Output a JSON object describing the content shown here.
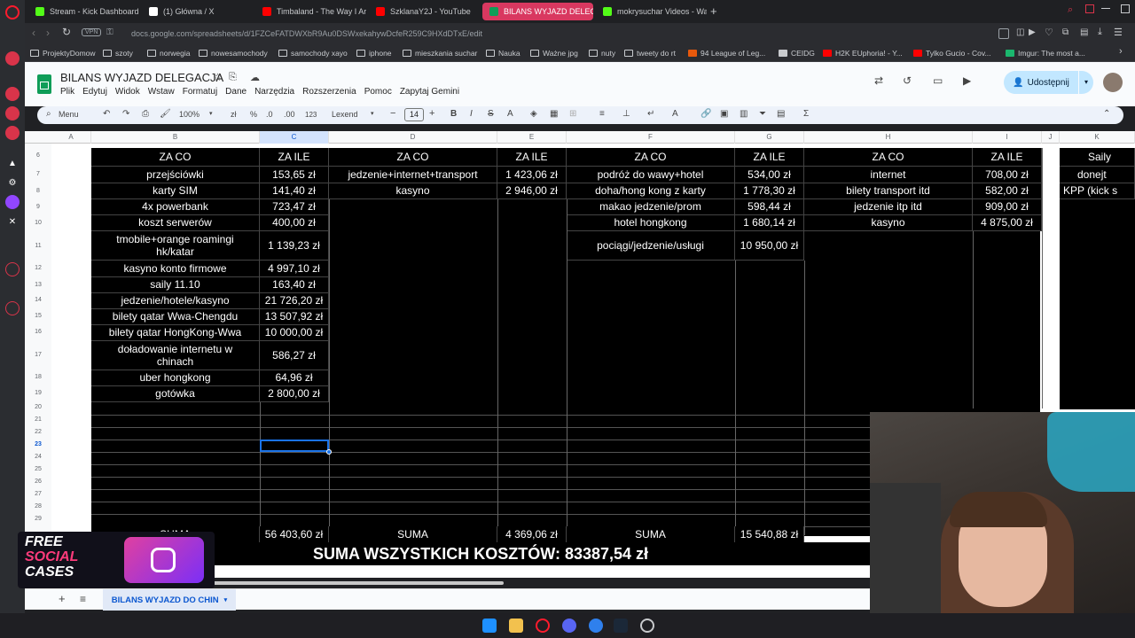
{
  "browser": {
    "tabs": [
      {
        "label": "Stream - Kick Dashboard",
        "color": "#53fc18",
        "active": false
      },
      {
        "label": "(1) Główna / X",
        "color": "#ffffff",
        "active": false
      },
      {
        "label": "Timbaland - The Way I Are",
        "color": "#ff0000",
        "active": false
      },
      {
        "label": "SzklanaY2J - YouTube",
        "color": "#ff0000",
        "active": false
      },
      {
        "label": "BILANS WYJAZD DELEGACJA",
        "color": "#0f9d58",
        "active": true
      },
      {
        "label": "mokrysuchar Videos - Wa...",
        "color": "#53fc18",
        "active": false
      }
    ],
    "vpn_label": "VPN",
    "url": "docs.google.com/spreadsheets/d/1FZCeFATDWXbR9Au0DSWxekahywDcfeR259C9HXdDTxE/edit",
    "bookmarks": [
      "ProjektyDomow",
      "szoty",
      "norwegia",
      "nowesamochody",
      "samochody xayo",
      "iphone",
      "mieszkania suchar",
      "Nauka",
      "Ważne jpg",
      "nuty",
      "tweety do rt",
      "94 League of Leg...",
      "CEIDG",
      "H2K EUphoria! - Y...",
      "Tylko Gucio - Cov...",
      "Imgur: The most a..."
    ]
  },
  "sheets": {
    "title": "BILANS WYJAZD DELEGACJA",
    "menu": [
      "Plik",
      "Edytuj",
      "Widok",
      "Wstaw",
      "Formatuj",
      "Dane",
      "Narzędzia",
      "Rozszerzenia",
      "Pomoc",
      "Zapytaj Gemini"
    ],
    "share_label": "Udostępnij",
    "toolbar": {
      "menu_label": "Menu",
      "zoom": "100%",
      "number_format": "123",
      "font": "Lexend",
      "font_size": "14"
    },
    "columns": [
      "A",
      "B",
      "C",
      "D",
      "E",
      "F",
      "G",
      "H",
      "I",
      "J",
      "K"
    ],
    "rows": [
      "6",
      "7",
      "8",
      "9",
      "10",
      "11",
      "12",
      "13",
      "14",
      "15",
      "16",
      "17",
      "18",
      "19",
      "20",
      "21",
      "22",
      "23",
      "24",
      "25",
      "26",
      "27",
      "28",
      "29"
    ],
    "headers": {
      "b": "ZA CO",
      "c": "ZA ILE",
      "d": "ZA CO",
      "e": "ZA ILE",
      "f": "ZA CO",
      "g": "ZA ILE",
      "h": "ZA CO",
      "i": "ZA ILE",
      "k": "Saily"
    },
    "col_b": [
      "przejściówki",
      "karty SIM",
      "4x powerbank",
      "koszt serwerów",
      "tmobile+orange roamingi hk/katar",
      "kasyno konto firmowe",
      "saily 11.10",
      "jedzenie/hotele/kasyno",
      "bilety qatar Wwa-Chengdu",
      "bilety qatar HongKong-Wwa",
      "doładowanie internetu w chinach",
      "uber hongkong",
      "gotówka"
    ],
    "col_c": [
      "153,65 zł",
      "141,40 zł",
      "723,47 zł",
      "400,00 zł",
      "1 139,23 zł",
      "4 997,10 zł",
      "163,40 zł",
      "21 726,20 zł",
      "13 507,92 zł",
      "10 000,00 zł",
      "586,27 zł",
      "64,96 zł",
      "2 800,00 zł"
    ],
    "col_d": [
      "jedzenie+internet+transport",
      "kasyno"
    ],
    "col_e": [
      "1 423,06 zł",
      "2 946,00 zł"
    ],
    "col_f": [
      "podróż do wawy+hotel",
      "doha/hong kong z karty",
      "makao jedzenie/prom",
      "hotel hongkong",
      "pociągi/jedzenie/usługi"
    ],
    "col_g": [
      "534,00 zł",
      "1 778,30 zł",
      "598,44 zł",
      "1 680,14 zł",
      "10 950,00 zł"
    ],
    "col_h": [
      "internet",
      "bilety transport itd",
      "jedzenie itp itd",
      "kasyno"
    ],
    "col_i": [
      "708,00 zł",
      "582,00 zł",
      "909,00 zł",
      "4 875,00 zł"
    ],
    "col_k": [
      "donejt",
      "KPP (kick s"
    ],
    "sums": {
      "b_label": "SUMA",
      "c": "56 403,60 zł",
      "d_label": "SUMA",
      "e": "4 369,06 zł",
      "f_label": "SUMA",
      "g": "15 540,88 zł"
    },
    "grand_total": "SUMA WSZYSTKICH KOSZTÓW: 83387,54 zł",
    "sheet_tab": "BILANS WYJAZD DO CHIN"
  },
  "overlay": {
    "promo_line1": "FREE",
    "promo_line2": "SOCIAL",
    "promo_line3": "CASES"
  }
}
